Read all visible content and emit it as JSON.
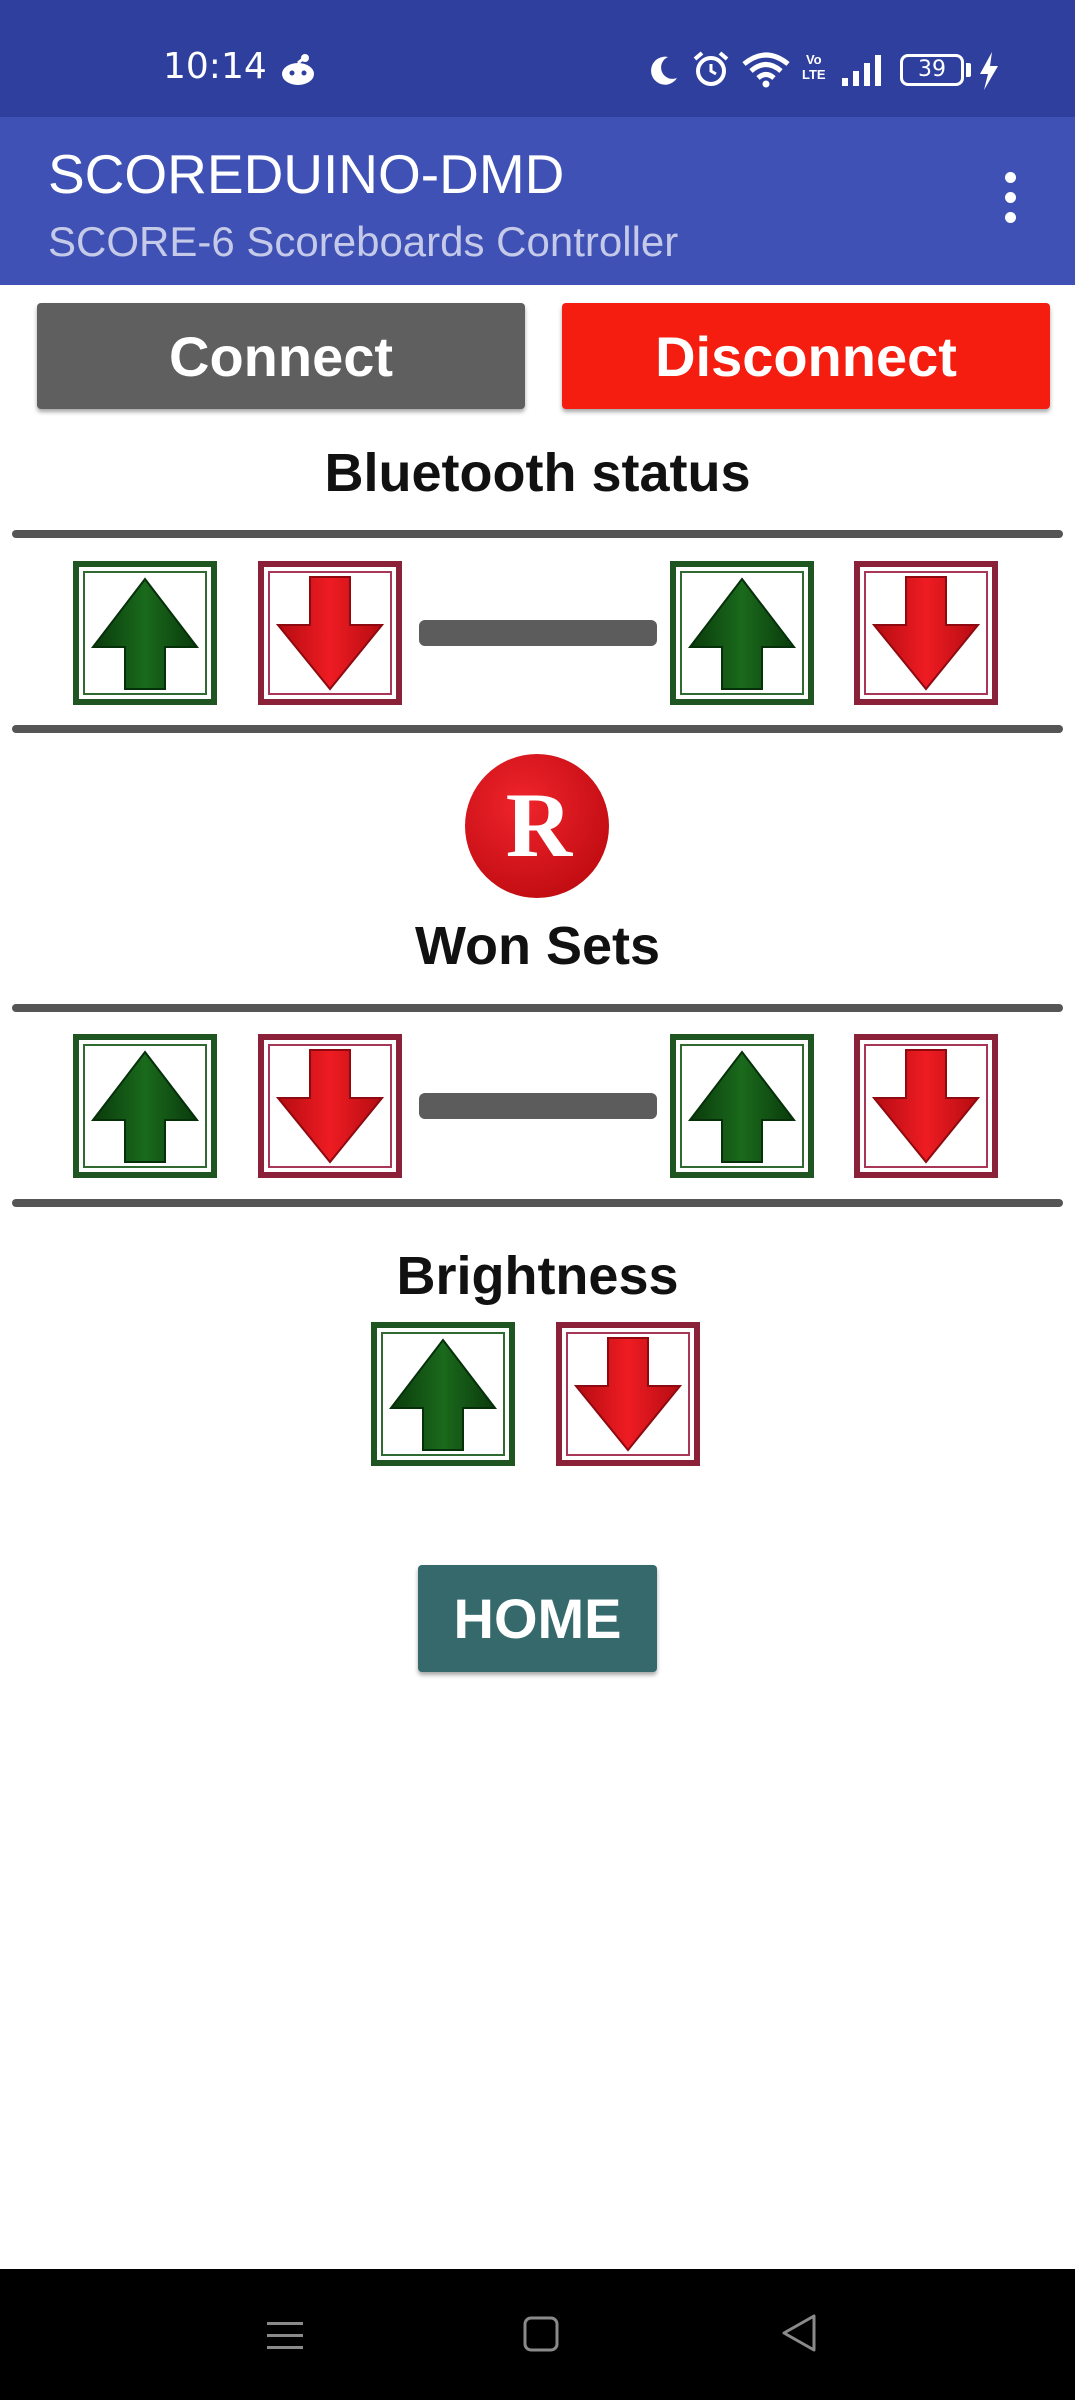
{
  "status_bar": {
    "time": "10:14",
    "volte": [
      "Vo",
      "LTE"
    ],
    "battery_level": "39",
    "icons": [
      "notification-icon",
      "moon-icon",
      "alarm-icon",
      "wifi-icon",
      "volte-icon",
      "signal-icon",
      "battery-icon",
      "charging-bolt-icon"
    ]
  },
  "app_bar": {
    "title": "SCOREDUINO-DMD",
    "subtitle": "SCORE-6 Scoreboards Controller",
    "menu_icon": "more-vert-icon"
  },
  "connection": {
    "connect_label": "Connect",
    "disconnect_label": "Disconnect",
    "status_label": "Bluetooth status"
  },
  "won_sets": {
    "label": "Won Sets"
  },
  "brightness": {
    "label": "Brightness"
  },
  "home": {
    "label": "HOME"
  },
  "logo": {
    "letter": "R"
  },
  "colors": {
    "status_bar": "#2f3f9e",
    "app_bar": "#3f51b5",
    "connect": "#5f5f5f",
    "disconnect": "#f51d10",
    "home": "#35696b",
    "up_arrow": "#0f4f12",
    "down_arrow": "#e0151b",
    "up_frame": "#1f5521",
    "down_frame": "#8a2139"
  }
}
